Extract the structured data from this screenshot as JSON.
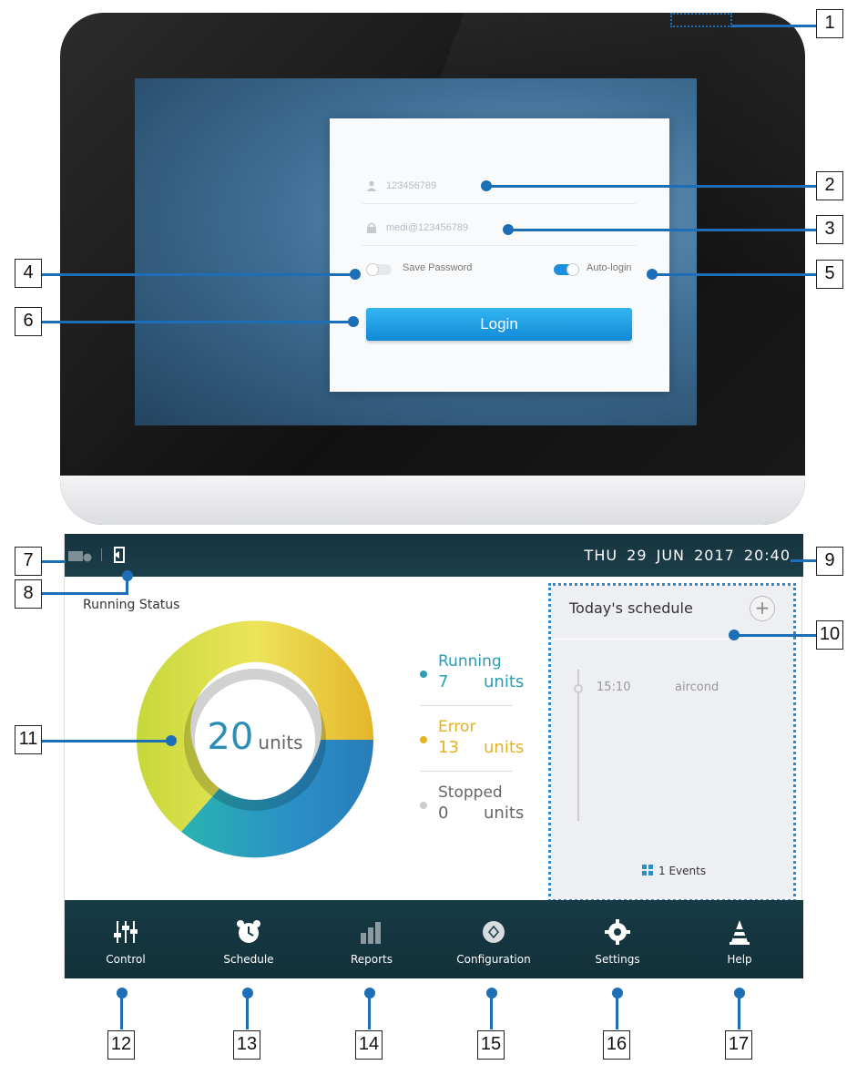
{
  "callouts": [
    "1",
    "2",
    "3",
    "4",
    "5",
    "6",
    "7",
    "8",
    "9",
    "10",
    "11",
    "12",
    "13",
    "14",
    "15",
    "16",
    "17"
  ],
  "login": {
    "username_placeholder": "123456789",
    "password_placeholder": "medi@123456789",
    "save_password_label": "Save Password",
    "auto_login_label": "Auto-login",
    "login_button": "Login",
    "save_password_on": false,
    "auto_login_on": true
  },
  "topbar": {
    "datetime": "THU  29  JUN  2017  20:40"
  },
  "running_status": {
    "title": "Running Status",
    "total_count": "20",
    "total_unit": "units",
    "legend": [
      {
        "name": "Running",
        "count": "7",
        "unit": "units",
        "color": "#2a9db5"
      },
      {
        "name": "Error",
        "count": "13",
        "unit": "units",
        "color": "#e4b21e"
      },
      {
        "name": "Stopped",
        "count": "0",
        "unit": "units",
        "color": "#999999"
      }
    ]
  },
  "schedule": {
    "title": "Today's schedule",
    "add_symbol": "+",
    "entries": [
      {
        "time": "15:10",
        "event": "aircond"
      }
    ],
    "events_count": "1 Events"
  },
  "nav": [
    {
      "label": "Control",
      "icon": "sliders-icon"
    },
    {
      "label": "Schedule",
      "icon": "alarm-clock-icon"
    },
    {
      "label": "Reports",
      "icon": "bar-chart-icon"
    },
    {
      "label": "Configuration",
      "icon": "configuration-icon"
    },
    {
      "label": "Settings",
      "icon": "gear-icon"
    },
    {
      "label": "Help",
      "icon": "cone-icon"
    }
  ],
  "colors": {
    "accent_blue": "#1c6fb7",
    "topbar": "#15333e",
    "running": "#2a9db5",
    "error": "#e4b21e",
    "stopped": "#999999"
  }
}
